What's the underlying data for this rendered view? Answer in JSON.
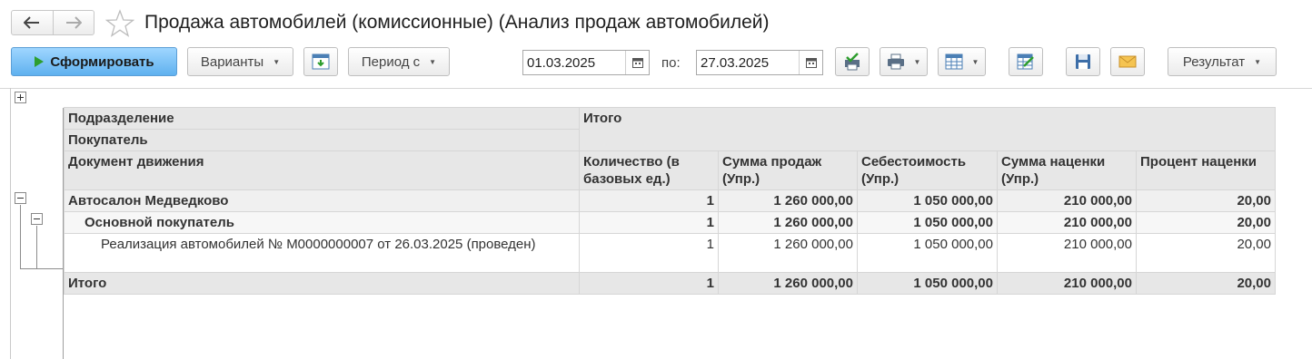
{
  "window": {
    "title": "Продажа автомобилей (комиссионные) (Анализ продаж автомобилей)"
  },
  "toolbar": {
    "generate_label": "Сформировать",
    "variants_label": "Варианты",
    "period_label": "Период с",
    "date_from": "01.03.2025",
    "to_label": "по:",
    "date_to": "27.03.2025",
    "result_label": "Результат"
  },
  "report": {
    "header": {
      "row_groups": [
        "Подразделение",
        "Покупатель",
        "Документ движения"
      ],
      "total_label": "Итого",
      "columns": [
        "Количество (в базовых ед.)",
        "Сумма продаж (Упр.)",
        "Себестоимость (Упр.)",
        "Сумма наценки (Упр.)",
        "Процент наценки"
      ]
    },
    "rows": [
      {
        "label": "Автосалон Медведково",
        "values": [
          "1",
          "1 260 000,00",
          "1 050 000,00",
          "210 000,00",
          "20,00"
        ]
      },
      {
        "label": "Основной покупатель",
        "values": [
          "1",
          "1 260 000,00",
          "1 050 000,00",
          "210 000,00",
          "20,00"
        ]
      },
      {
        "label": "Реализация автомобилей № М0000000007 от 26.03.2025 (проведен)",
        "values": [
          "1",
          "1 260 000,00",
          "1 050 000,00",
          "210 000,00",
          "20,00"
        ]
      }
    ],
    "total": {
      "label": "Итого",
      "values": [
        "1",
        "1 260 000,00",
        "1 050 000,00",
        "210 000,00",
        "20,00"
      ]
    }
  },
  "colors": {
    "primary_button": "#5fb1ef",
    "header_bg": "#e7e7e7",
    "play_icon": "#2e9e2e"
  }
}
